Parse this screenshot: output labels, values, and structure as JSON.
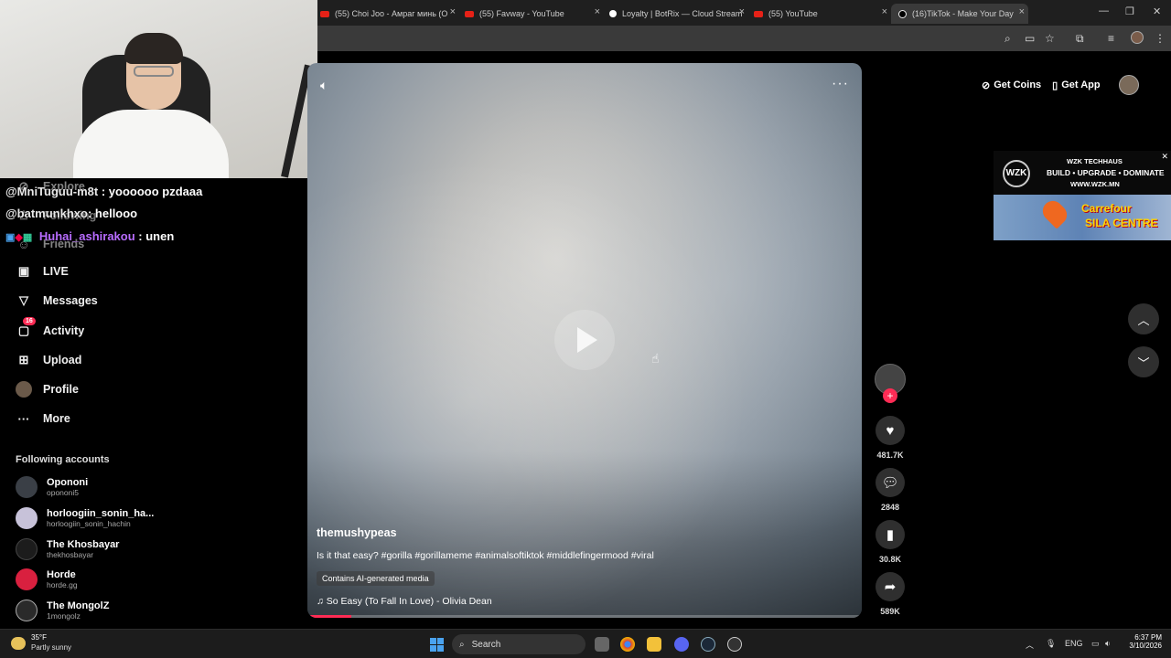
{
  "browser": {
    "tabs": [
      {
        "title": "(55) Choi Joo - Амраг минь (O",
        "icon": "youtube-icon"
      },
      {
        "title": "(55) Favway - YouTube",
        "icon": "youtube-icon"
      },
      {
        "title": "Loyalty | BotRix — Cloud Stream",
        "icon": "botrix-icon"
      },
      {
        "title": "(55) YouTube",
        "icon": "youtube-icon"
      },
      {
        "title": "(16)TikTok - Make Your Day",
        "icon": "tiktok-icon",
        "active": true
      }
    ],
    "new_tab": "+",
    "close_glyph": "×"
  },
  "chat": [
    {
      "user": "@MniTuguu-m8t",
      "message": " : yoooooo pzdaaa"
    },
    {
      "user": "@batmunkhxo",
      "message": ": hellooo"
    },
    {
      "user": "Huhai_ashirakou",
      "message": " : unen"
    }
  ],
  "sidebar": {
    "partial_items": [
      "Explore",
      "Following",
      "Friends"
    ],
    "items": [
      {
        "label": "LIVE",
        "icon": "live-icon"
      },
      {
        "label": "Messages",
        "icon": "messages-icon"
      },
      {
        "label": "Activity",
        "icon": "activity-icon",
        "badge": "16"
      },
      {
        "label": "Upload",
        "icon": "upload-icon"
      },
      {
        "label": "Profile",
        "icon": "profile-icon"
      },
      {
        "label": "More",
        "icon": "more-icon"
      }
    ],
    "following_title": "Following accounts",
    "following": [
      {
        "name": "Opononi",
        "handle": "opononi5"
      },
      {
        "name": "horloogiin_sonin_ha...",
        "handle": "horloogiin_sonin_hachin"
      },
      {
        "name": "The Khosbayar",
        "handle": "thekhosbayar"
      },
      {
        "name": "Horde",
        "handle": "horde.gg"
      },
      {
        "name": "The MongolZ",
        "handle": "1mongolz"
      }
    ]
  },
  "video": {
    "author": "themushypeas",
    "caption": "Is it that easy? #gorilla #gorillameme #animalsoftiktok #middlefingermood #viral",
    "ai_label": "Contains AI-generated media",
    "music": "So Easy (To Fall In Love) - Olivia Dean",
    "progress": 0.08
  },
  "actions": {
    "likes": "481.7K",
    "comments": "2848",
    "saves": "30.8K",
    "shares": "589K"
  },
  "topbar": {
    "get_coins": "Get Coins",
    "get_app": "Get App"
  },
  "ad": {
    "logo": "WZK",
    "line1": "WZK TECHHAUS",
    "line2": "BUILD • UPGRADE • DOMINATE",
    "line3": "WWW.WZK.MN",
    "store1": "Carrefour",
    "store2": "SILA CENTRE"
  },
  "taskbar": {
    "temp": "35°F",
    "weather": "Partly sunny",
    "search": "Search",
    "lang": "ENG",
    "time": "6:37 PM",
    "date": "3/10/2026"
  }
}
